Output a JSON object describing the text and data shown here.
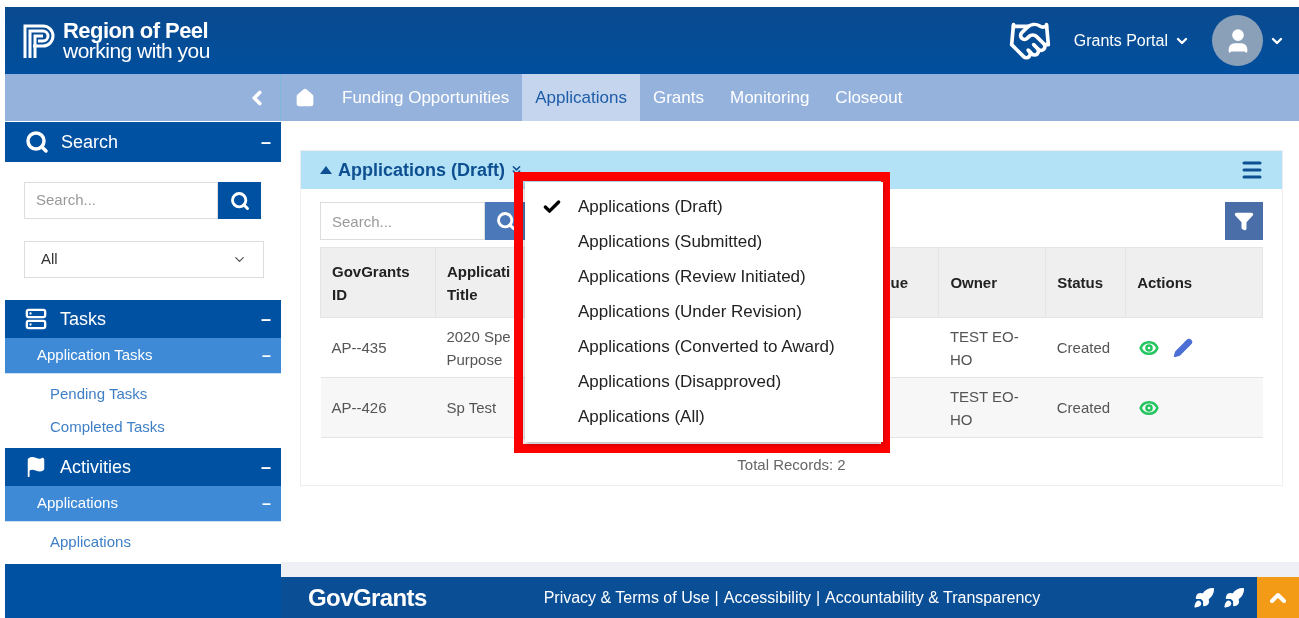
{
  "header": {
    "logo": {
      "title": "Region of Peel",
      "subtitle": "working with you"
    },
    "portal_menu": "Grants Portal"
  },
  "nav": {
    "tabs": [
      {
        "label": "Funding Opportunities",
        "selected": false
      },
      {
        "label": "Applications",
        "selected": true
      },
      {
        "label": "Grants",
        "selected": false
      },
      {
        "label": "Monitoring",
        "selected": false
      },
      {
        "label": "Closeout",
        "selected": false
      }
    ]
  },
  "sidebar": {
    "search": {
      "title": "Search",
      "toggle": "–",
      "placeholder": "Search...",
      "filter_value": "All"
    },
    "sections": [
      {
        "title": "Tasks",
        "kind": "tasks",
        "toggle": "–",
        "groups": [
          {
            "title": "Application Tasks",
            "toggle": "–",
            "items": [
              "Pending Tasks",
              "Completed Tasks"
            ]
          }
        ]
      },
      {
        "title": "Activities",
        "kind": "activities",
        "toggle": "–",
        "groups": [
          {
            "title": "Applications",
            "toggle": "–",
            "items": [
              "Applications"
            ]
          }
        ]
      }
    ]
  },
  "panel": {
    "title": "Applications (Draft)",
    "search_placeholder": "Search...",
    "table": {
      "columns": [
        {
          "label": "GovGrants ID"
        },
        {
          "label": "Applicati Title"
        },
        {
          "label": "ue"
        },
        {
          "label": "Owner"
        },
        {
          "label": "Status"
        },
        {
          "label": "Actions"
        }
      ],
      "rows": [
        {
          "cells": [
            "AP--435",
            "2020 Spe Purpose",
            "",
            "TEST EO-HO",
            "Created"
          ],
          "actions": [
            {
              "kind": "view"
            },
            {
              "kind": "edit"
            }
          ]
        },
        {
          "cells": [
            "AP--426",
            "Sp Test",
            "",
            "TEST EO-HO",
            "Created"
          ],
          "actions": [
            {
              "kind": "view"
            }
          ]
        }
      ]
    },
    "total": "Total Records: 2"
  },
  "dropdown": {
    "items": [
      {
        "label": "Applications (Draft)",
        "selected": true
      },
      {
        "label": "Applications (Submitted)",
        "selected": false
      },
      {
        "label": "Applications (Review Initiated)",
        "selected": false
      },
      {
        "label": "Applications (Under Revision)",
        "selected": false
      },
      {
        "label": "Applications (Converted to Award)",
        "selected": false
      },
      {
        "label": "Applications (Disapproved)",
        "selected": false
      },
      {
        "label": "Applications (All)",
        "selected": false
      }
    ]
  },
  "footer": {
    "brand": "GovGrants",
    "links": [
      "Privacy & Terms of Use",
      "Accessibility",
      "Accountability & Transparency"
    ],
    "separator": "|"
  }
}
